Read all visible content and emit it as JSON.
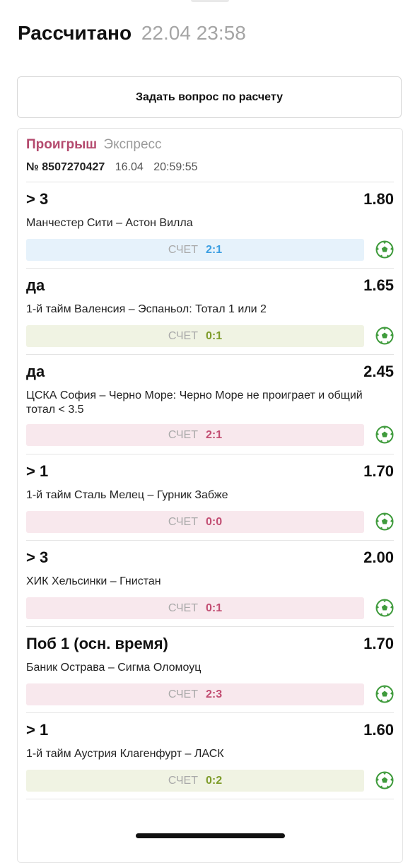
{
  "header": {
    "status": "Рассчитано",
    "datetime": "22.04 23:58"
  },
  "ask_button": {
    "label": "Задать вопрос по расчету"
  },
  "bet": {
    "result": "Проигрыш",
    "type": "Экспресс",
    "number": "№ 8507270427",
    "date": "16.04",
    "time": "20:59:55",
    "score_label": "СЧЕТ",
    "sport_icon": "soccer-ball-icon",
    "colors": {
      "loss": "#b44a6e",
      "blue": "#3b9ee2",
      "green": "#7e9c2a",
      "pink": "#c24d72"
    },
    "events": [
      {
        "pick": "> 3",
        "odds": "1.80",
        "name": "Манчестер Сити – Астон Вилла",
        "score": "2:1",
        "state": "blue"
      },
      {
        "pick": "да",
        "odds": "1.65",
        "name": "1-й тайм Валенсия – Эспаньол: Тотал 1 или 2",
        "score": "0:1",
        "state": "green"
      },
      {
        "pick": "да",
        "odds": "2.45",
        "name": "ЦСКА София – Черно Море: Черно Море не проиграет и общий тотал < 3.5",
        "score": "2:1",
        "state": "pink"
      },
      {
        "pick": "> 1",
        "odds": "1.70",
        "name": "1-й тайм Сталь Мелец – Гурник Забже",
        "score": "0:0",
        "state": "pink"
      },
      {
        "pick": "> 3",
        "odds": "2.00",
        "name": "ХИК Хельсинки – Гнистан",
        "score": "0:1",
        "state": "pink"
      },
      {
        "pick": "Поб 1 (осн. время)",
        "odds": "1.70",
        "name": "Баник Острава – Сигма Оломоуц",
        "score": "2:3",
        "state": "pink"
      },
      {
        "pick": "> 1",
        "odds": "1.60",
        "name": "1-й тайм Аустрия Клагенфурт – ЛАСК",
        "score": "0:2",
        "state": "green"
      }
    ]
  }
}
